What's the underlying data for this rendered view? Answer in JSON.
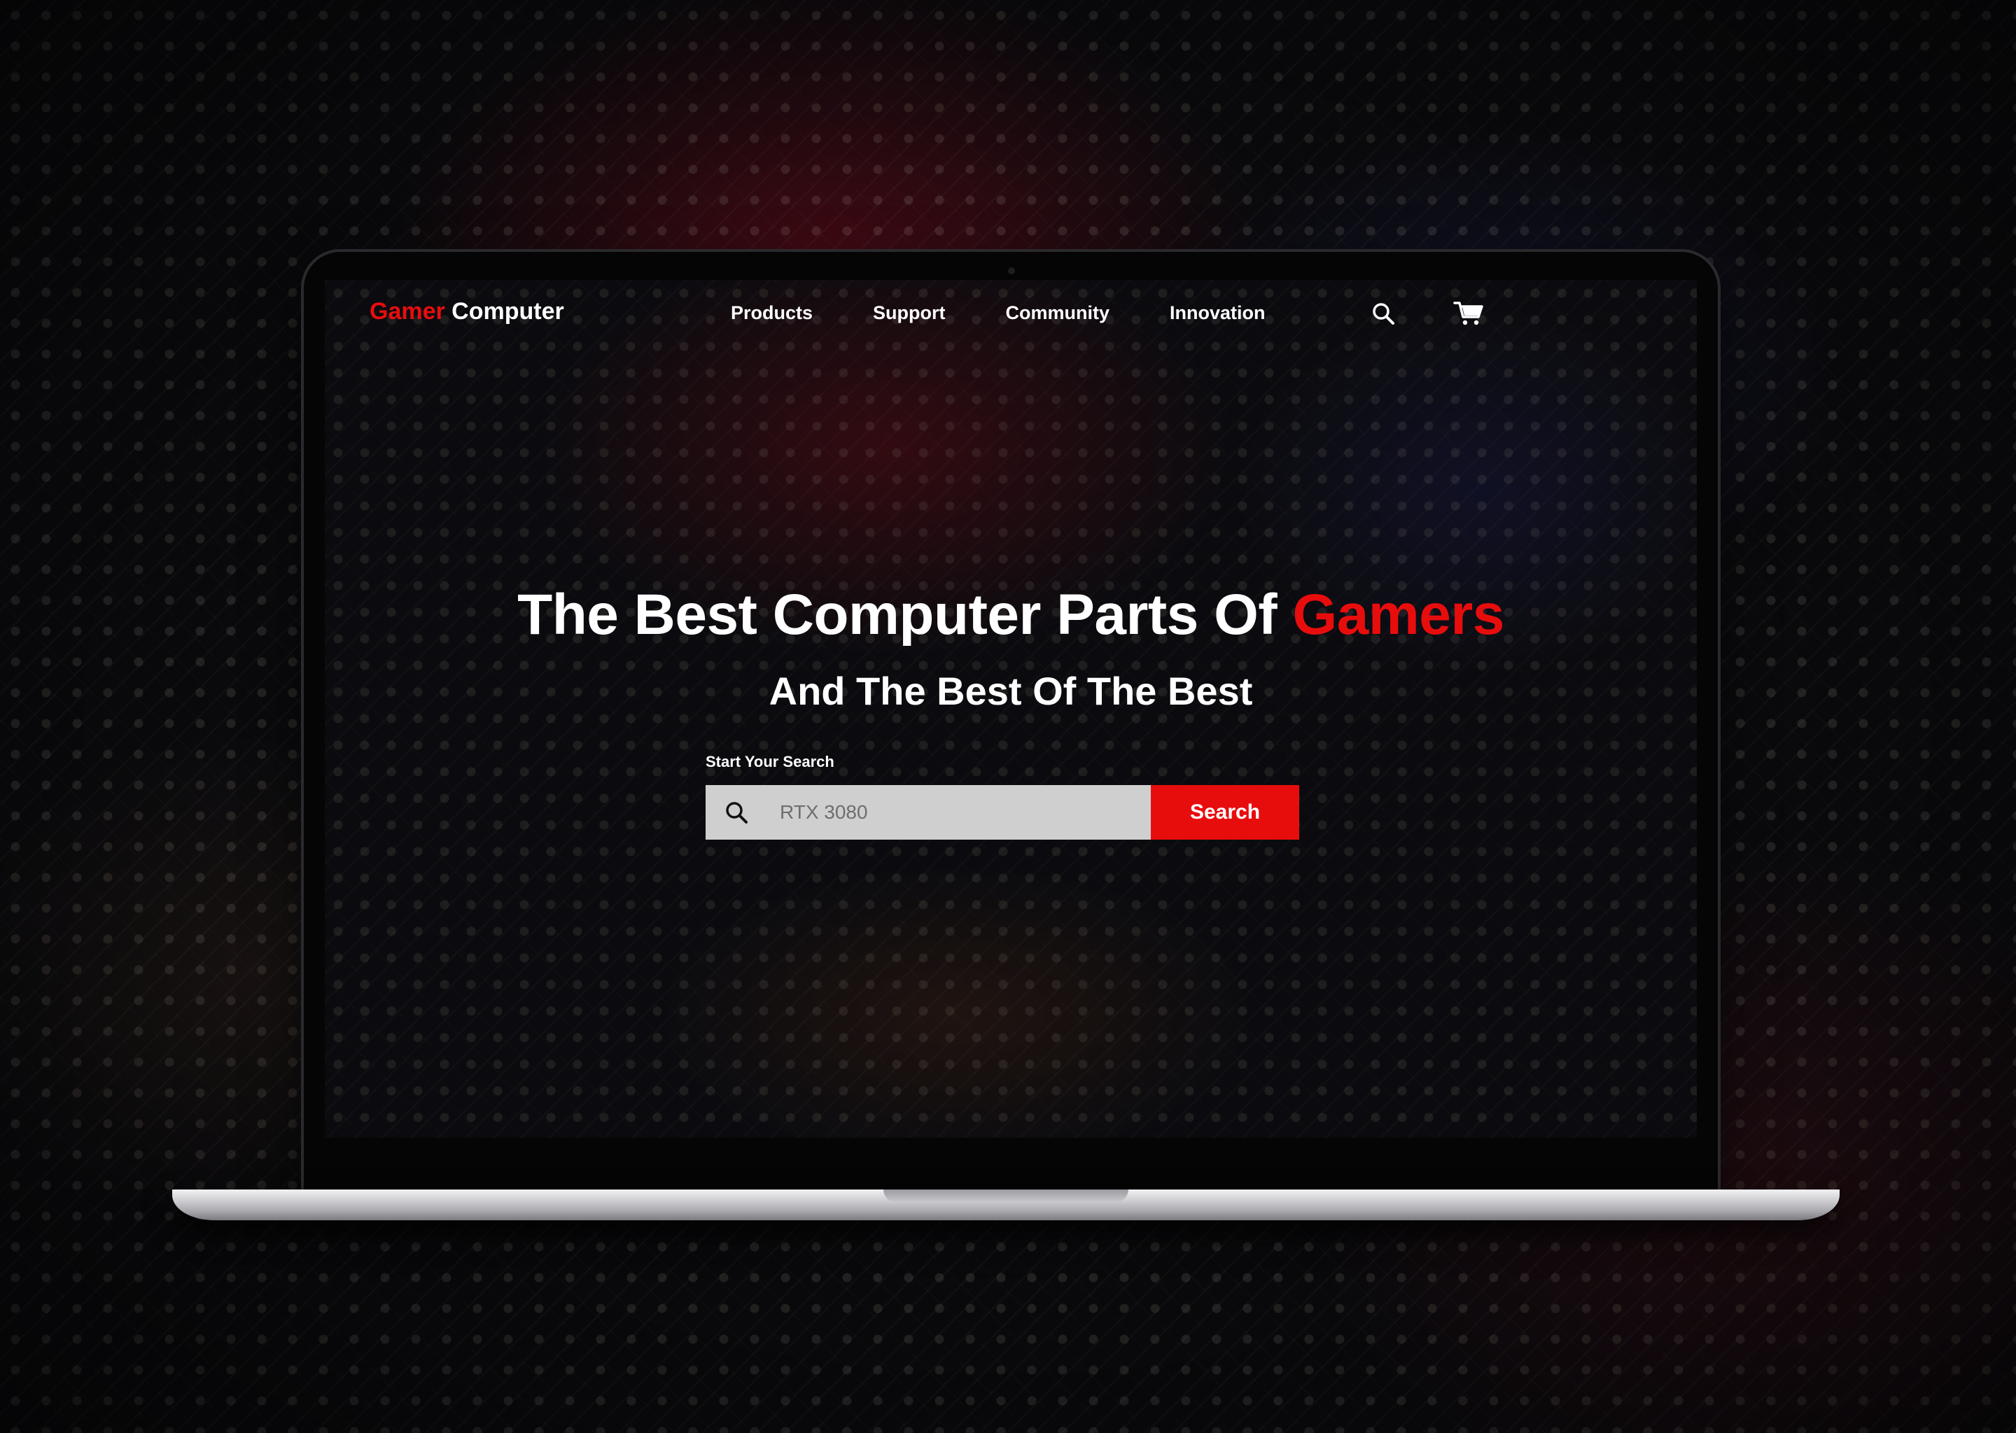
{
  "nav": {
    "logo_accent": "Gamer",
    "logo_rest": " Computer",
    "links": [
      "Products",
      "Support",
      "Community",
      "Innovation"
    ],
    "search_icon": "search-icon",
    "cart_icon": "cart-icon"
  },
  "hero": {
    "title_main": "The Best Computer Parts Of ",
    "title_accent": "Gamers",
    "subtitle": "And The Best Of The Best"
  },
  "search": {
    "label": "Start Your Search",
    "placeholder": "RTX 3080",
    "button_label": "Search",
    "icon": "search-icon"
  },
  "colors": {
    "accent": "#e80d0d",
    "text": "#ffffff",
    "field_bg": "#cfcfcf"
  }
}
